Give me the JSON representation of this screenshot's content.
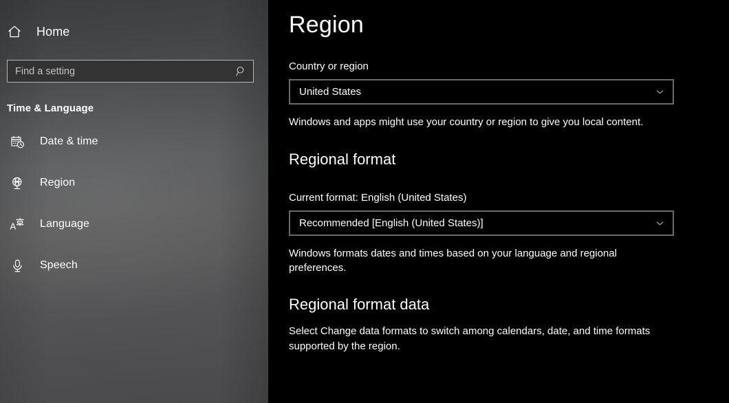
{
  "sidebar": {
    "home": {
      "label": "Home",
      "icon": "home-icon"
    },
    "search": {
      "placeholder": "Find a setting",
      "value": "",
      "icon": "search-icon"
    },
    "section_title": "Time & Language",
    "items": [
      {
        "label": "Date & time",
        "icon": "calendar-clock-icon"
      },
      {
        "label": "Region",
        "icon": "globe-icon"
      },
      {
        "label": "Language",
        "icon": "language-icon"
      },
      {
        "label": "Speech",
        "icon": "microphone-icon"
      }
    ]
  },
  "content": {
    "page_title": "Region",
    "country": {
      "label": "Country or region",
      "selected": "United States",
      "help": "Windows and apps might use your country or region to give you local content."
    },
    "regional_format": {
      "heading": "Regional format",
      "current_label": "Current format: English (United States)",
      "selected": "Recommended [English (United States)]",
      "help": "Windows formats dates and times based on your language and regional preferences."
    },
    "regional_format_data": {
      "heading": "Regional format data",
      "help": "Select Change data formats to switch among calendars, date, and time formats supported by the region."
    }
  },
  "colors": {
    "content_bg": "#000000",
    "sidebar_top": "#3b3d3f",
    "sidebar_mid": "#5c5c5d",
    "text": "#ffffff",
    "control_border": "#6a6a6a",
    "search_border": "#b6b6b6",
    "search_bg": "#333334"
  }
}
